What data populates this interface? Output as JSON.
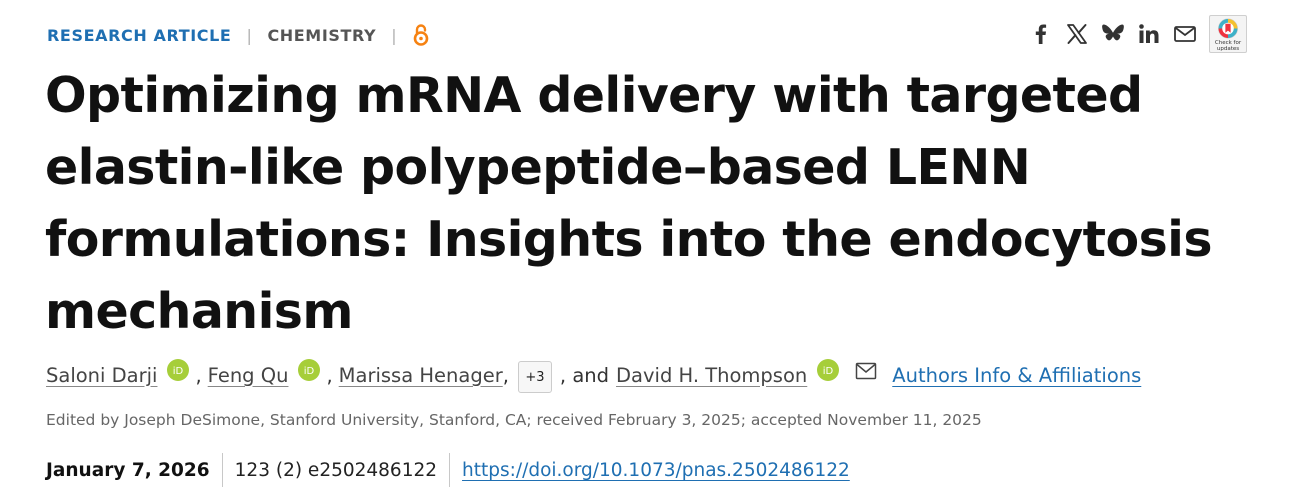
{
  "header": {
    "article_type": "RESEARCH ARTICLE",
    "separator": "|",
    "subject": "CHEMISTRY",
    "open_access_icon": "open-access-icon"
  },
  "share_icons": [
    "facebook-icon",
    "x-icon",
    "bluesky-icon",
    "linkedin-icon",
    "email-icon"
  ],
  "check_updates": {
    "line1": "Check for",
    "line2": "updates"
  },
  "title": "Optimizing mRNA delivery with targeted elastin-like polypeptide–based LENN formulations: Insights into the endocytosis mechanism",
  "authors": {
    "list": [
      {
        "name": "Saloni Darji",
        "sep": ","
      },
      {
        "name": "Feng Qu",
        "sep": ","
      },
      {
        "name": "Marissa Henager",
        "sep": ","
      }
    ],
    "more_label": "+3",
    "and_text": ", and",
    "last_author": "David H. Thompson",
    "affiliations_link": "Authors Info & Affiliations"
  },
  "edited_line": "Edited by Joseph DeSimone, Stanford University, Stanford, CA; received February 3, 2025; accepted November 11, 2025",
  "publication": {
    "date": "January 7, 2026",
    "citation": "123 (2) e2502486122",
    "doi": "https://doi.org/10.1073/pnas.2502486122"
  },
  "colors": {
    "accent": "#1f6fb2",
    "orcid": "#a6ce39",
    "open_access": "#f68212"
  }
}
